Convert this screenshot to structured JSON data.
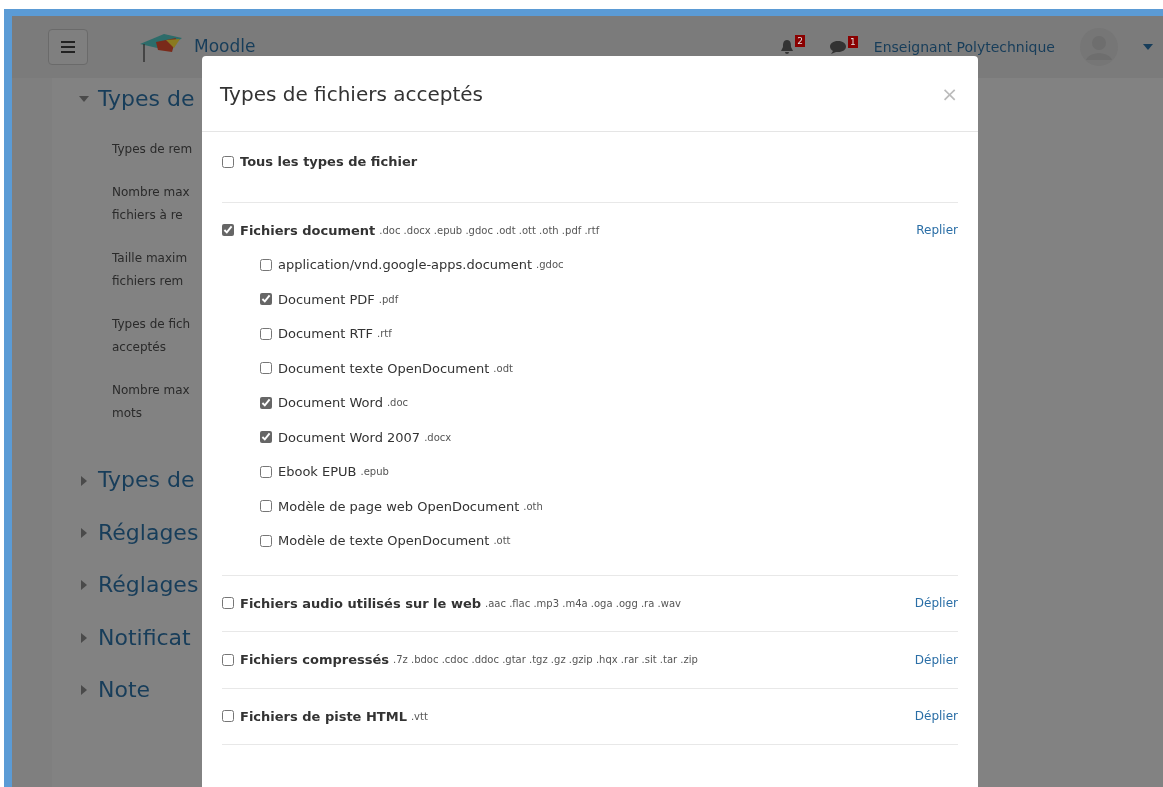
{
  "navbar": {
    "brand": "Moodle",
    "notification_count": "2",
    "message_count": "1",
    "user_name": "Enseignant Polytechnique"
  },
  "background_page": {
    "sections": [
      {
        "title": "Types de",
        "expanded": true,
        "fields": [
          [
            "Types de rem"
          ],
          [
            "Nombre max",
            "fichiers à re"
          ],
          [
            "Taille maxim",
            "fichiers rem"
          ],
          [
            "Types de fich",
            "acceptés"
          ],
          [
            "Nombre max",
            "mots"
          ]
        ]
      },
      {
        "title": "Types de",
        "expanded": false
      },
      {
        "title": "Réglages",
        "expanded": false
      },
      {
        "title": "Réglages",
        "expanded": false
      },
      {
        "title": "Notificat",
        "expanded": false
      },
      {
        "title": "Note",
        "expanded": false
      }
    ]
  },
  "modal": {
    "title": "Types de fichiers acceptés",
    "close": "×",
    "groups": [
      {
        "kind": "all",
        "label": "Tous les types de fichier",
        "checked": false
      },
      {
        "kind": "group",
        "label": "Fichiers document",
        "extensions": ".doc .docx .epub .gdoc .odt .ott .oth .pdf .rtf",
        "checked": true,
        "toggle": "Replier",
        "items": [
          {
            "label": "application/vnd.google-apps.document",
            "extension": ".gdoc",
            "checked": false
          },
          {
            "label": "Document PDF",
            "extension": ".pdf",
            "checked": true
          },
          {
            "label": "Document RTF",
            "extension": ".rtf",
            "checked": false
          },
          {
            "label": "Document texte OpenDocument",
            "extension": ".odt",
            "checked": false
          },
          {
            "label": "Document Word",
            "extension": ".doc",
            "checked": true
          },
          {
            "label": "Document Word 2007",
            "extension": ".docx",
            "checked": true
          },
          {
            "label": "Ebook EPUB",
            "extension": ".epub",
            "checked": false
          },
          {
            "label": "Modèle de page web OpenDocument",
            "extension": ".oth",
            "checked": false
          },
          {
            "label": "Modèle de texte OpenDocument",
            "extension": ".ott",
            "checked": false
          }
        ]
      },
      {
        "kind": "group",
        "label": "Fichiers audio utilisés sur le web",
        "extensions": ".aac .flac .mp3 .m4a .oga .ogg .ra .wav",
        "checked": false,
        "toggle": "Déplier"
      },
      {
        "kind": "group",
        "label": "Fichiers compressés",
        "extensions": ".7z .bdoc .cdoc .ddoc .gtar .tgz .gz .gzip .hqx .rar .sit .tar .zip",
        "checked": false,
        "toggle": "Déplier"
      },
      {
        "kind": "group",
        "label": "Fichiers de piste HTML",
        "extensions": ".vtt",
        "checked": false,
        "toggle": "Déplier"
      }
    ]
  }
}
